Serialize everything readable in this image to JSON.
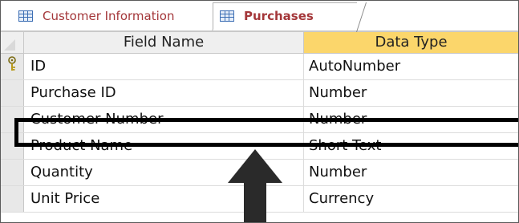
{
  "tabs": [
    {
      "label": "Customer Information",
      "icon": "table-icon",
      "active": false
    },
    {
      "label": "Purchases",
      "icon": "table-icon",
      "active": true
    }
  ],
  "columns": {
    "field_name": "Field Name",
    "data_type": "Data Type"
  },
  "rows": [
    {
      "field": "ID",
      "type": "AutoNumber",
      "primary_key": true
    },
    {
      "field": "Purchase ID",
      "type": "Number"
    },
    {
      "field": "Customer Number",
      "type": "Number",
      "highlighted": true
    },
    {
      "field": "Product Name",
      "type": "Short Text"
    },
    {
      "field": "Quantity",
      "type": "Number"
    },
    {
      "field": "Unit Price",
      "type": "Currency"
    }
  ],
  "colors": {
    "tab_text": "#a4373a",
    "header_active": "#fbd66b",
    "highlight": "#000000"
  },
  "annotation": {
    "arrow": "up-arrow-icon"
  }
}
